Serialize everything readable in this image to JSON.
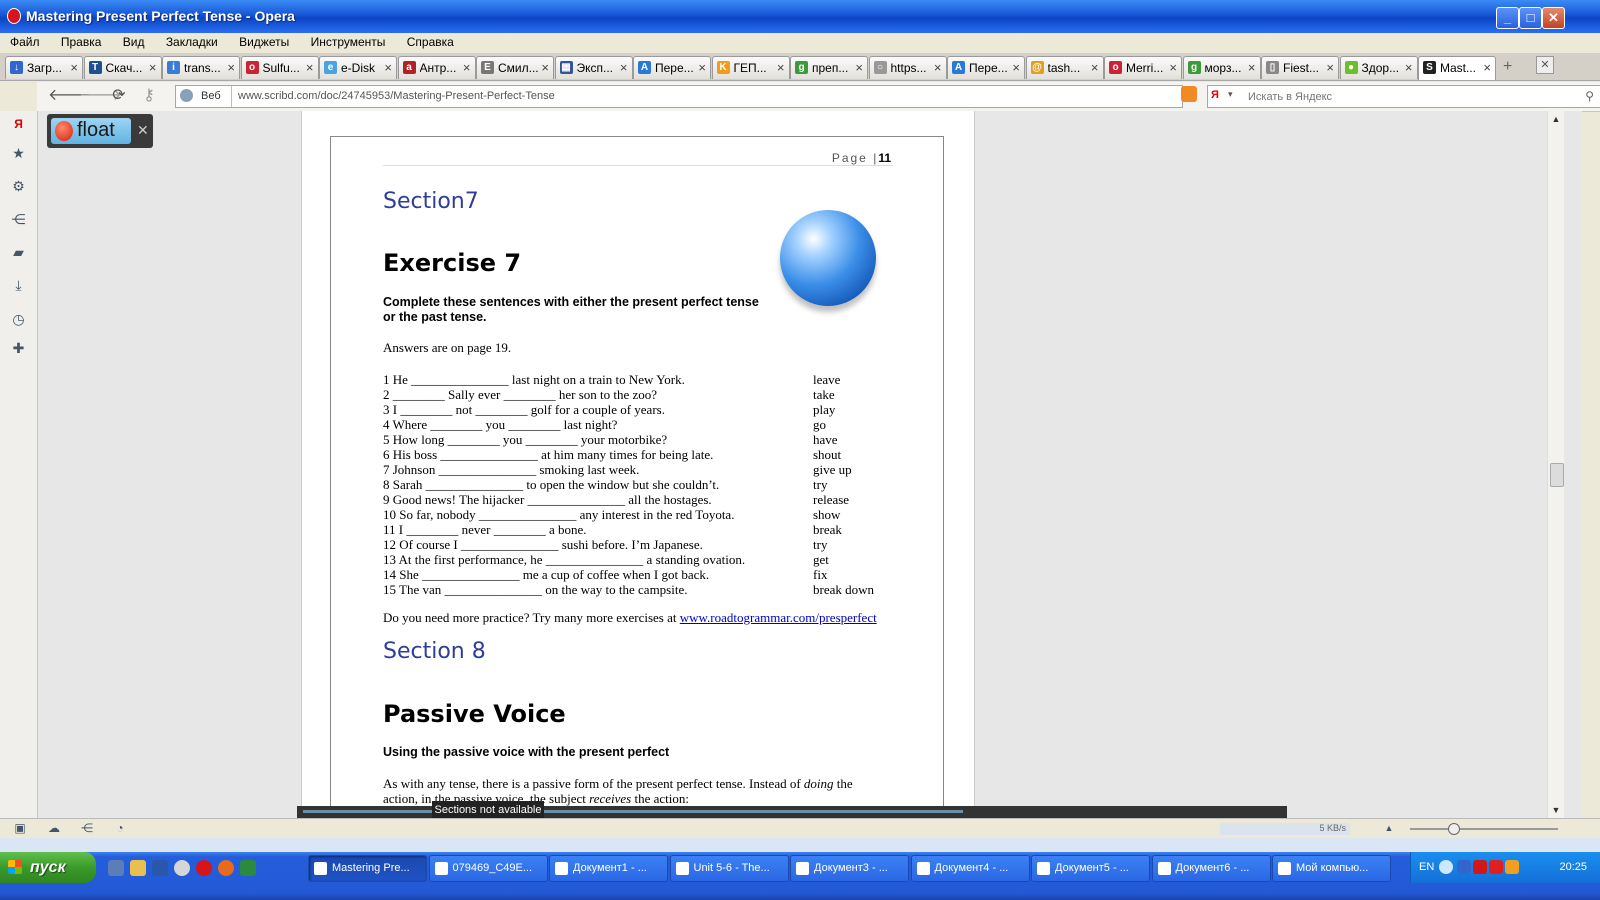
{
  "window": {
    "title": "Mastering Present Perfect Tense - Opera"
  },
  "menu": [
    "Файл",
    "Правка",
    "Вид",
    "Закладки",
    "Виджеты",
    "Инструменты",
    "Справка"
  ],
  "tabs": [
    {
      "label": "Загр...",
      "color": "#3366cc",
      "glyph": "↓"
    },
    {
      "label": "Скач...",
      "color": "#1d4f91",
      "glyph": "T"
    },
    {
      "label": "trans...",
      "color": "#3a7bd5",
      "glyph": "i"
    },
    {
      "label": "Sulfu...",
      "color": "#cc2233",
      "glyph": "o"
    },
    {
      "label": "e-Disk",
      "color": "#4aa3df",
      "glyph": "e"
    },
    {
      "label": "Антр...",
      "color": "#b22222",
      "glyph": "a"
    },
    {
      "label": "Смил...",
      "color": "#777777",
      "glyph": "E"
    },
    {
      "label": "Эксп...",
      "color": "#335599",
      "glyph": "▦"
    },
    {
      "label": "Пере...",
      "color": "#2a7ad5",
      "glyph": "A"
    },
    {
      "label": "ГЕП...",
      "color": "#f29b1d",
      "glyph": "K"
    },
    {
      "label": "преп...",
      "color": "#3b9a3b",
      "glyph": "g"
    },
    {
      "label": "https...",
      "color": "#999999",
      "glyph": "○"
    },
    {
      "label": "Пере...",
      "color": "#2a7ad5",
      "glyph": "A"
    },
    {
      "label": "tash...",
      "color": "#e0a020",
      "glyph": "@"
    },
    {
      "label": "Merri...",
      "color": "#cc2233",
      "glyph": "o"
    },
    {
      "label": "морз...",
      "color": "#3b9a3b",
      "glyph": "g"
    },
    {
      "label": "Fiest...",
      "color": "#888888",
      "glyph": "▯"
    },
    {
      "label": "Здор...",
      "color": "#6cbf2a",
      "glyph": "●"
    },
    {
      "label": "Mast...",
      "color": "#222222",
      "glyph": "S"
    }
  ],
  "address": {
    "web_label": "Веб",
    "url": "www.scribd.com/doc/24745953/Mastering-Present-Perfect-Tense",
    "search_engine": "Я",
    "search_placeholder": "Искать в Яндекс"
  },
  "float_widget": {
    "label": "float"
  },
  "document": {
    "page_label": "Page",
    "page_number": "11",
    "section7": "Section7",
    "exercise_title": "Exercise 7",
    "exercise_instruction": "Complete these sentences with either the present perfect tense or the past tense.",
    "answers_note": "Answers are on page 19.",
    "items": [
      {
        "text": "1 He _______________ last night on a train to New York.",
        "verb": "leave"
      },
      {
        "text": "2 ________ Sally ever ________ her son to the zoo?",
        "verb": "take"
      },
      {
        "text": "3 I ________ not ________ golf for a couple of years.",
        "verb": "play"
      },
      {
        "text": "4 Where ________ you ________ last night?",
        "verb": "go"
      },
      {
        "text": "5 How long ________ you ________ your motorbike?",
        "verb": "have"
      },
      {
        "text": "6 His boss _______________ at him many times for being late.",
        "verb": "shout"
      },
      {
        "text": "7 Johnson _______________ smoking last week.",
        "verb": "give up"
      },
      {
        "text": "8 Sarah _______________ to open the window but she couldn’t.",
        "verb": "try"
      },
      {
        "text": "9 Good news! The hijacker _______________ all the hostages.",
        "verb": "release"
      },
      {
        "text": "10 So far, nobody _______________ any interest in the red Toyota.",
        "verb": "show"
      },
      {
        "text": "11 I ________ never ________ a bone.",
        "verb": "break"
      },
      {
        "text": "12 Of course I _______________ sushi before. I’m Japanese.",
        "verb": "try"
      },
      {
        "text": "13 At the first performance, he _______________ a standing ovation.",
        "verb": "get"
      },
      {
        "text": "14 She _______________ me a cup of coffee when I got back.",
        "verb": "fix"
      },
      {
        "text": "15 The van _______________ on the way to the campsite.",
        "verb": "break down"
      }
    ],
    "practice_text": "Do you need more practice? Try many more exercises at",
    "practice_link": "www.roadtogrammar.com/presperfect",
    "section8": "Section 8",
    "passive_title": "Passive Voice",
    "passive_subtitle": "Using the passive voice with the present perfect",
    "passive_body_1a": "As with any tense, there is a passive form of the present perfect tense. Instead of",
    "passive_body_1b": "doing",
    "passive_body_1c": "the",
    "passive_body_2a": "action, in the passive voice, the subject",
    "passive_body_2b": "receives",
    "passive_body_2c": "the action:"
  },
  "sections_tooltip": "Sections not available",
  "status": {
    "speed": "5 KB/s"
  },
  "taskbar": {
    "start_label": "пуск",
    "items": [
      {
        "label": "Mastering Pre...",
        "active": true
      },
      {
        "label": "079469_C49E...",
        "active": false
      },
      {
        "label": "Документ1 - ...",
        "active": false
      },
      {
        "label": "Unit 5-6 - The...",
        "active": false
      },
      {
        "label": "Документ3 - ...",
        "active": false
      },
      {
        "label": "Документ4 - ...",
        "active": false
      },
      {
        "label": "Документ5 - ...",
        "active": false
      },
      {
        "label": "Документ6 - ...",
        "active": false
      },
      {
        "label": "Мой компью...",
        "active": false
      }
    ],
    "lang": "EN",
    "clock": "20:25"
  },
  "colors": {
    "accent": "#2d3d99",
    "titlebar": "#0b45c4",
    "link": "#0000cc"
  }
}
